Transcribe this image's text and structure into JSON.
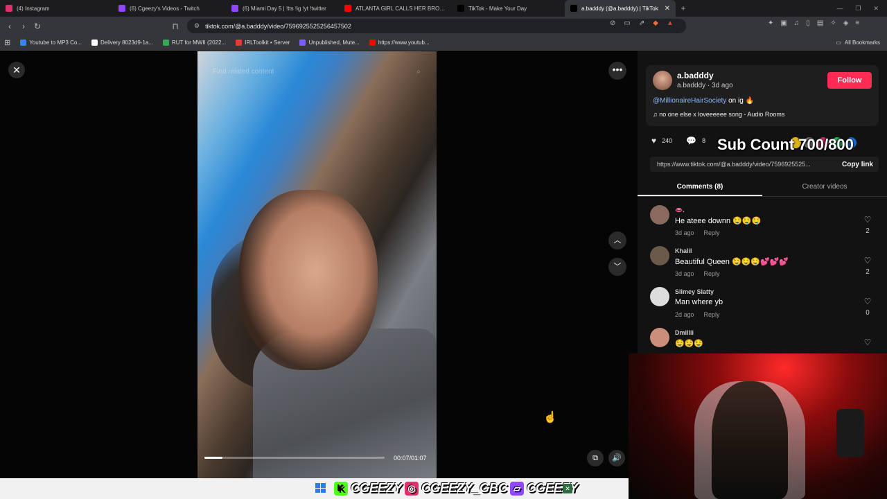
{
  "browser": {
    "tabs": [
      {
        "label": "(4) Instagram",
        "color": "#e1306c",
        "active": false
      },
      {
        "label": "(6) Cgeezy's Videos - Twitch",
        "color": "#9146ff",
        "active": false
      },
      {
        "label": "(6) Miami Day 5 | !tts !ig !yt !twitter",
        "color": "#9146ff",
        "active": false
      },
      {
        "label": "ATLANTA GIRL CALLS HER BROTHER",
        "color": "#ff0000",
        "active": false
      },
      {
        "label": "TikTok - Make Your Day",
        "color": "#000000",
        "active": false
      },
      {
        "label": "a.badddy (@a.badddy) | TikTok",
        "color": "#000000",
        "active": true
      }
    ],
    "new_tab": "+",
    "url": "tiktok.com/@a.badddy/video/7596925525256457502",
    "bookmarks": [
      {
        "label": "Youtube to MP3 Co...",
        "color": "#3b82f6"
      },
      {
        "label": "Delivery 8023d9-1a...",
        "color": "#ffffff"
      },
      {
        "label": "RUT for MWII (2022...",
        "color": "#34a853"
      },
      {
        "label": "IRLToolkit • Server",
        "color": "#e53935"
      },
      {
        "label": "Unpublished, Mute...",
        "color": "#7b5cff"
      },
      {
        "label": "https://www.youtub...",
        "color": "#ff0000"
      }
    ],
    "all_bookmarks": "All Bookmarks"
  },
  "video": {
    "search_placeholder": "Find related content",
    "time": "00:07/01:07",
    "progress": 0.1
  },
  "post": {
    "username": "a.badddy",
    "subline": "a.badddy · 3d ago",
    "follow_label": "Follow",
    "caption_mention": "@MillionaireHairSociety",
    "caption_rest": " on ig 🔥",
    "music": "♫  no one else x loveeeeee song - Audio Rooms",
    "likes": "240",
    "comments_count": "8",
    "link": "https://www.tiktok.com/@a.badddy/video/7596925525...",
    "copy_link": "Copy link",
    "tab_comments": "Comments (8)",
    "tab_creator": "Creator videos"
  },
  "overlay": {
    "sub_count": "Sub Count 700/800"
  },
  "comments": [
    {
      "user": "👄.",
      "text": "He ateee downn 🤤🤤🤤",
      "age": "3d ago",
      "reply": "Reply",
      "likes": "2",
      "avatar_color": "#8a6a5e"
    },
    {
      "user": "Khalil",
      "text": "Beautiful Queen 🤤🤤🤤💕💕💕",
      "age": "3d ago",
      "reply": "Reply",
      "likes": "2",
      "avatar_color": "#6b5a4a"
    },
    {
      "user": "Slimey Slatty",
      "text": "Man where yb",
      "age": "2d ago",
      "reply": "Reply",
      "likes": "0",
      "avatar_color": "#dddddd"
    },
    {
      "user": "Dmillii",
      "text": "🤤🤤🤤",
      "age": "",
      "reply": "",
      "likes": "",
      "avatar_color": "#c98f7a"
    }
  ],
  "stream_bar": {
    "kick": "CGEEZY",
    "instagram": "CGEEZY_GBC",
    "twitch": "CGEEZY"
  }
}
